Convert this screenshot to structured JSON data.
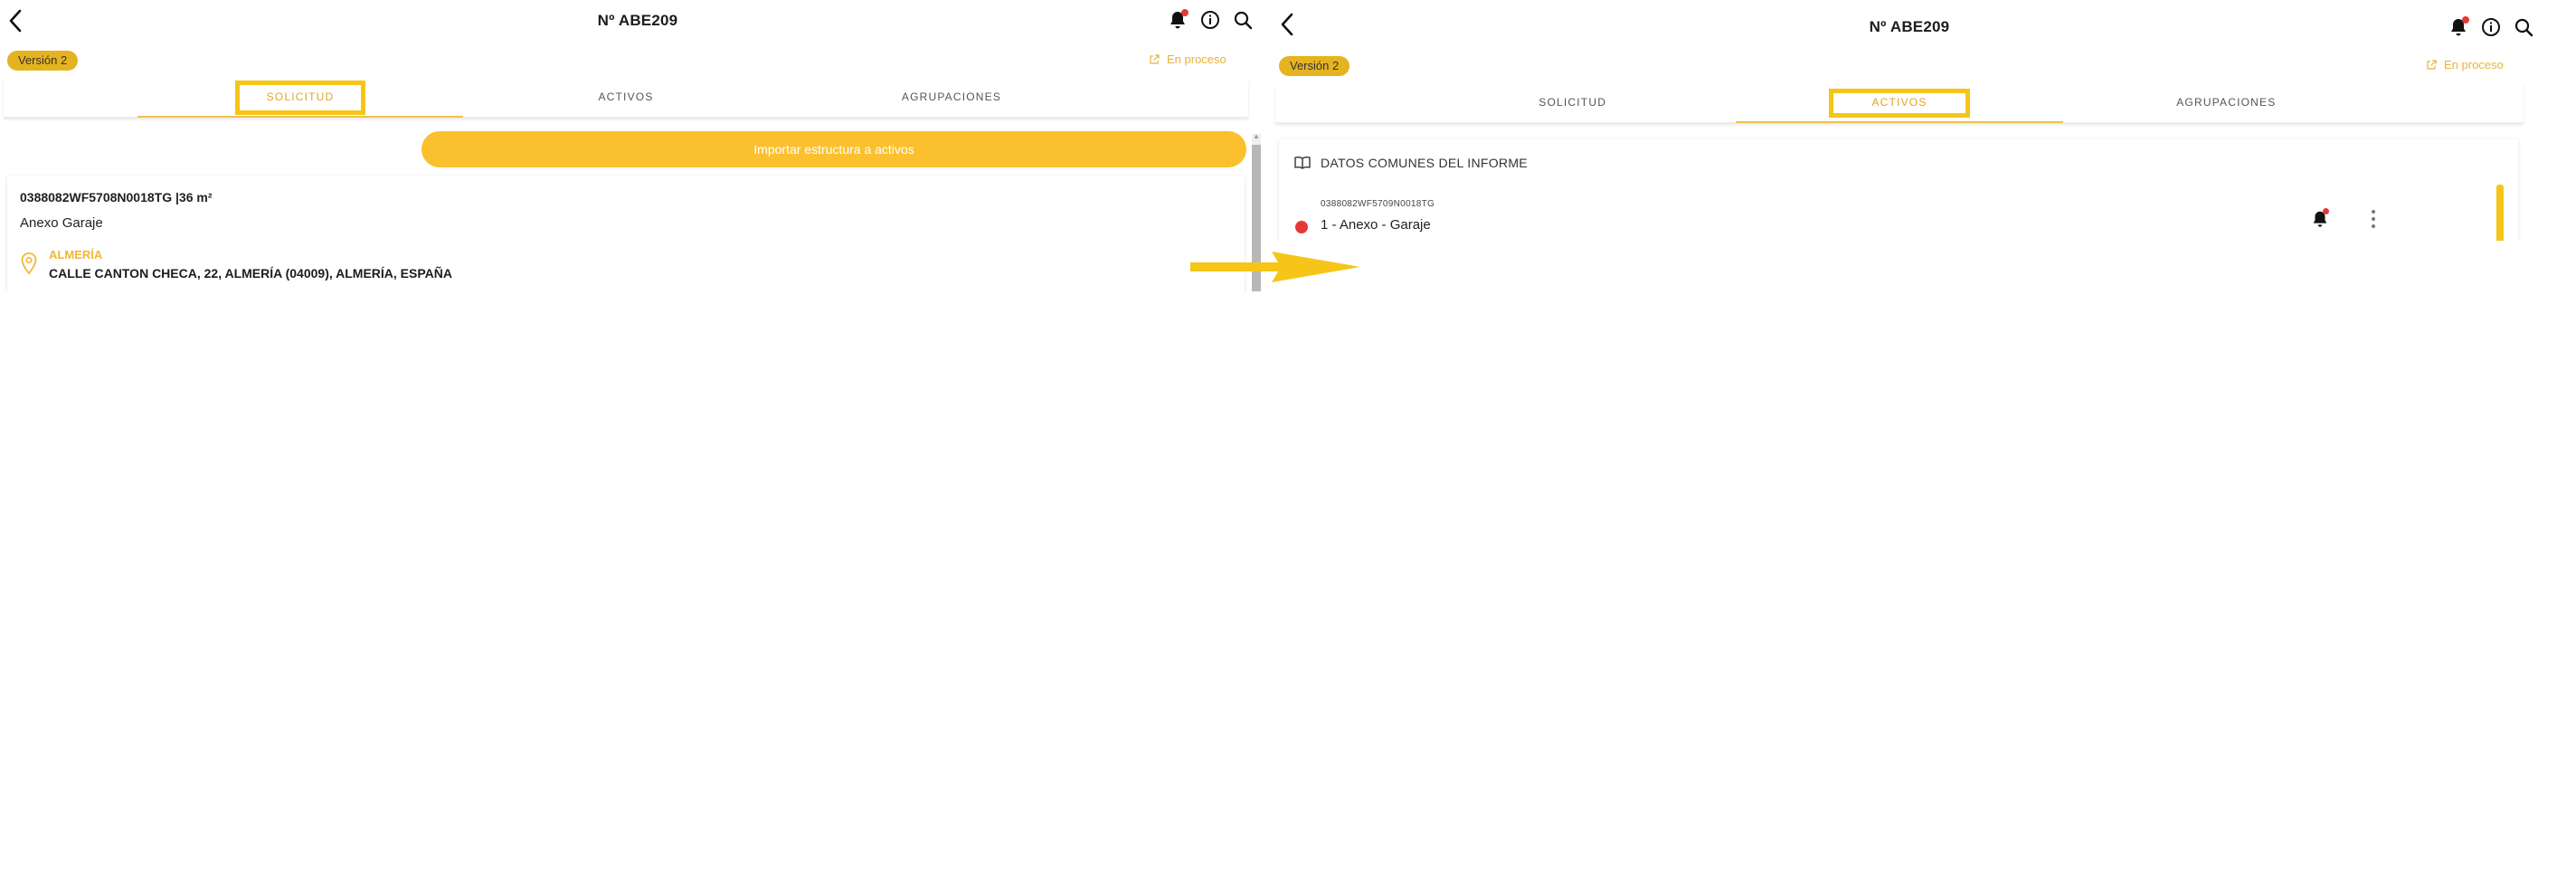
{
  "left_screen": {
    "header": {
      "title": "Nº ABE209"
    },
    "version_label": "Versión 2",
    "status_label": "En proceso",
    "tabs": [
      {
        "label": "SOLICITUD",
        "active": true
      },
      {
        "label": "ACTIVOS",
        "active": false
      },
      {
        "label": "AGRUPACIONES",
        "active": false
      }
    ],
    "import_button_label": "Importar estructura a activos",
    "asset": {
      "reference": "0388082WF5708N0018TG |36 m²",
      "type": "Anexo Garaje",
      "city": "ALMERÍA",
      "address": "CALLE CANTON CHECA, 22, ALMERÍA (04009), ALMERÍA, ESPAÑA"
    }
  },
  "right_screen": {
    "header": {
      "title": "Nº ABE209"
    },
    "version_label": "Versión 2",
    "status_label": "En proceso",
    "tabs": [
      {
        "label": "SOLICITUD",
        "active": false
      },
      {
        "label": "ACTIVOS",
        "active": true
      },
      {
        "label": "AGRUPACIONES",
        "active": false
      }
    ],
    "report_section_title": "DATOS COMUNES DEL INFORME",
    "asset_row": {
      "code": "0388082WF5709N0018TG",
      "name": "1 - Anexo - Garaje",
      "status_color": "#e53935"
    }
  },
  "theme": {
    "accent": "#f5c518",
    "badge": "#e6b320",
    "button": "#fbc02d",
    "alert": "#e53935"
  },
  "icons": [
    "back-arrow-icon",
    "bell-icon",
    "info-icon",
    "search-icon",
    "external-link-icon",
    "location-pin-icon",
    "book-icon",
    "more-vertical-icon",
    "transition-arrow-icon"
  ]
}
